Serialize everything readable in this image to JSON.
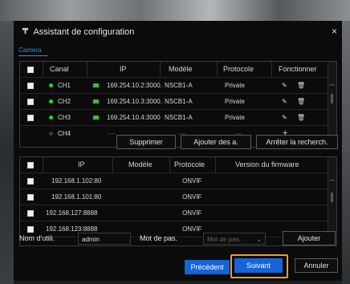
{
  "dialog": {
    "title": "Assistant de configuration",
    "close_label": "×",
    "title_icon": "wizard-pin-icon"
  },
  "tab": {
    "label": "Caméra"
  },
  "camera_table": {
    "headers": [
      "Canal",
      "IP",
      "Modèle",
      "Protocole",
      "Fonctionner"
    ],
    "rows": [
      {
        "channel": "CH1",
        "ip": "169.254.10.2:3000.",
        "model": "NSCB1-A",
        "protocol": "Private",
        "online": true,
        "actions": [
          "edit",
          "delete"
        ]
      },
      {
        "channel": "CH2",
        "ip": "169.254.10.3:3000.",
        "model": "NSCB1-A",
        "protocol": "Private",
        "online": true,
        "actions": [
          "edit",
          "delete"
        ]
      },
      {
        "channel": "CH3",
        "ip": "169.254.10.4:3000",
        "model": "NSCB1-A",
        "protocol": "Private",
        "online": true,
        "actions": [
          "edit",
          "delete"
        ]
      },
      {
        "channel": "CH4",
        "ip": "----",
        "model": "----",
        "protocol": "---",
        "online": false,
        "actions": [
          "add"
        ]
      }
    ],
    "add_symbol": "+"
  },
  "camera_actions": {
    "delete": "Supprimer",
    "add": "Ajouter des a.",
    "stop_search": "Arrêter la recherch."
  },
  "search_table": {
    "headers": [
      "IP",
      "Modèle",
      "Protocole",
      "Version du firmware"
    ],
    "rows": [
      {
        "ip": "192.168.1.102:80",
        "model": "",
        "protocol": "ONVIF",
        "firmware": ""
      },
      {
        "ip": "192.168.1.101:80",
        "model": "",
        "protocol": "ONVIF",
        "firmware": ""
      },
      {
        "ip": "192.168.127:8888",
        "model": "",
        "protocol": "ONVIF",
        "firmware": ""
      },
      {
        "ip": "192.168.123:8888",
        "model": "",
        "protocol": "ONVIF",
        "firmware": ""
      }
    ]
  },
  "credentials": {
    "user_label": "Nom d'utili.",
    "user_value": "admin",
    "pass_label": "Mot de pas.",
    "pass_placeholder": "Mot de pas.",
    "add_button": "Ajouter"
  },
  "footer": {
    "previous": "Précédent",
    "next": "Suivant",
    "cancel": "Annuler"
  },
  "colors": {
    "accent": "#1565d8",
    "online": "#29d329",
    "highlight": "#f39c2a"
  }
}
